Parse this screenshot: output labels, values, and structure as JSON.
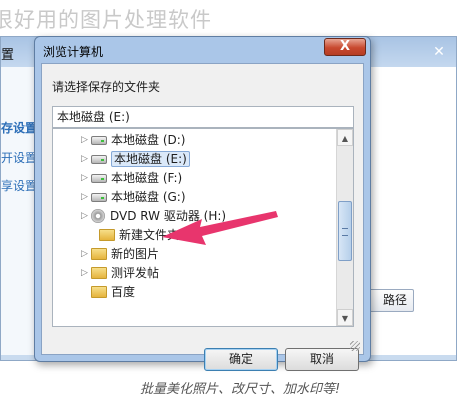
{
  "headline": "很好用的图片处理软件",
  "background_window": {
    "title": "置",
    "close_glyph": "✕",
    "sidebar": {
      "items": [
        {
          "label": "存设置"
        },
        {
          "label": "开设置"
        },
        {
          "label": "享设置"
        }
      ]
    },
    "path_button_label": "路径"
  },
  "dialog": {
    "title": "浏览计算机",
    "close_glyph": "X",
    "instruction": "请选择保存的文件夹",
    "path_value": "本地磁盘 (E:)",
    "tree": [
      {
        "label": "本地磁盘 (D:)",
        "icon": "drive-icon",
        "expand_glyph": "▷",
        "selected": false
      },
      {
        "label": "本地磁盘 (E:)",
        "icon": "drive-icon",
        "expand_glyph": "▷",
        "selected": true
      },
      {
        "label": "本地磁盘 (F:)",
        "icon": "drive-icon",
        "expand_glyph": "▷",
        "selected": false
      },
      {
        "label": "本地磁盘 (G:)",
        "icon": "drive-icon",
        "expand_glyph": "▷",
        "selected": false
      },
      {
        "label": "DVD RW 驱动器 (H:)",
        "icon": "dvd-icon",
        "expand_glyph": "▷",
        "selected": false
      },
      {
        "label": "新建文件夹",
        "icon": "folder-icon",
        "expand_glyph": "",
        "selected": false
      },
      {
        "label": "新的图片",
        "icon": "folder-icon",
        "expand_glyph": "▷",
        "selected": false
      },
      {
        "label": "测评发帖",
        "icon": "folder-icon",
        "expand_glyph": "▷",
        "selected": false
      },
      {
        "label": "百度",
        "icon": "folder-icon",
        "expand_glyph": "",
        "selected": false
      }
    ],
    "scroll_up_glyph": "▲",
    "scroll_down_glyph": "▼",
    "ok_label": "确定",
    "cancel_label": "取消"
  },
  "annotation": {
    "arrow_color": "#e8356d",
    "caption": "批量美化照片、改尺寸、加水印等!"
  },
  "colors": {
    "titlebar": "#aac6e8",
    "close_button": "#c8492f",
    "selection": "#dbe9f9",
    "accent_text": "#2d6fb8"
  }
}
